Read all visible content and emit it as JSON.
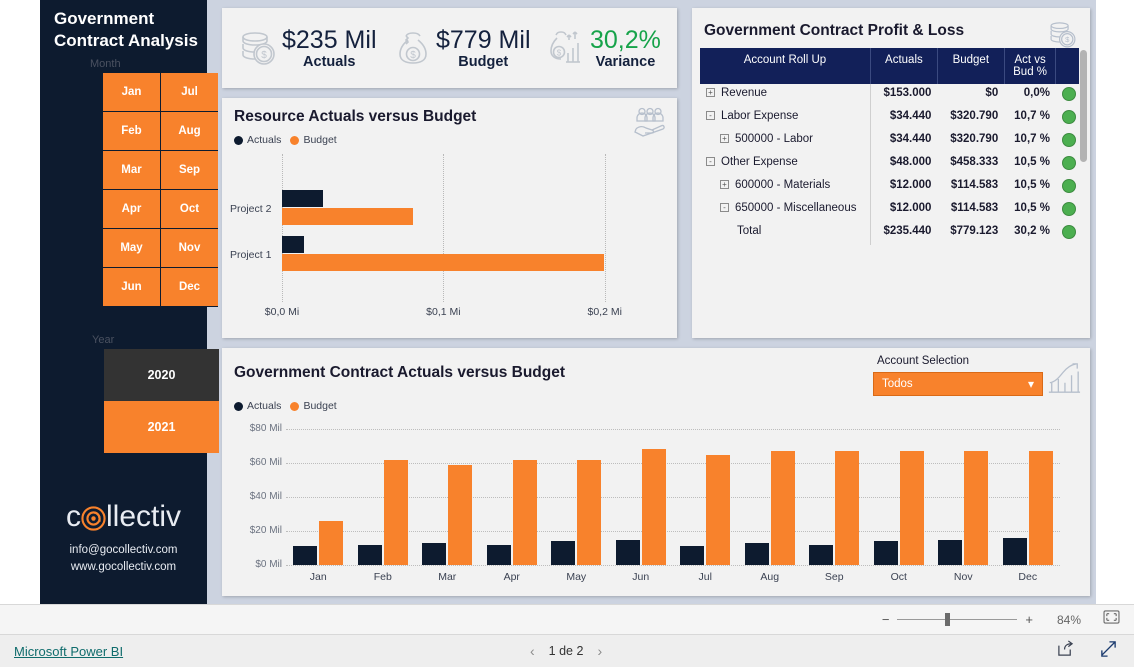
{
  "sidebar": {
    "title": "Government Contract Analysis",
    "month_label": "Month",
    "months": [
      "Jan",
      "Jul",
      "Feb",
      "Aug",
      "Mar",
      "Sep",
      "Apr",
      "Oct",
      "May",
      "Nov",
      "Jun",
      "Dec"
    ],
    "year_label": "Year",
    "years": [
      {
        "label": "2020",
        "selected": false
      },
      {
        "label": "2021",
        "selected": true
      }
    ],
    "logo": {
      "pre": "c",
      "post": "llectiv"
    },
    "email": "info@gocollectiv.com",
    "website": "www.gocollectiv.com"
  },
  "kpis": [
    {
      "value": "$235 Mil",
      "label": "Actuals",
      "icon": "coins-icon",
      "color": "#14213d"
    },
    {
      "value": "$779 Mil",
      "label": "Budget",
      "icon": "money-bag-icon",
      "color": "#14213d"
    },
    {
      "value": "30,2%",
      "label": "Variance",
      "icon": "money-growth-icon",
      "color": "#16a34a"
    }
  ],
  "resource_chart": {
    "title": "Resource Actuals versus Budget",
    "icon": "people-hand-icon",
    "legend": [
      "Actuals",
      "Budget"
    ]
  },
  "pl": {
    "title": "Government Contract Profit & Loss",
    "icon": "coins-icon",
    "columns": [
      "Account Roll Up",
      "Actuals",
      "Budget",
      "Act vs Bud %"
    ],
    "rows": [
      {
        "expander": "+",
        "indent": 0,
        "account": "Revenue",
        "actuals": "$153.000",
        "budget": "$0",
        "pct": "0,0%",
        "status": "green"
      },
      {
        "expander": "-",
        "indent": 0,
        "account": "Labor Expense",
        "actuals": "$34.440",
        "budget": "$320.790",
        "pct": "10,7 %",
        "status": "green"
      },
      {
        "expander": "+",
        "indent": 1,
        "account": "500000 - Labor",
        "actuals": "$34.440",
        "budget": "$320.790",
        "pct": "10,7 %",
        "status": "green"
      },
      {
        "expander": "-",
        "indent": 0,
        "account": "Other Expense",
        "actuals": "$48.000",
        "budget": "$458.333",
        "pct": "10,5 %",
        "status": "green"
      },
      {
        "expander": "+",
        "indent": 1,
        "account": "600000 - Materials",
        "actuals": "$12.000",
        "budget": "$114.583",
        "pct": "10,5 %",
        "status": "green"
      },
      {
        "expander": "-",
        "indent": 1,
        "account": "650000 - Miscellaneous",
        "actuals": "$12.000",
        "budget": "$114.583",
        "pct": "10,5 %",
        "status": "green"
      },
      {
        "expander": "",
        "indent": 1,
        "account": "Total",
        "actuals": "$235.440",
        "budget": "$779.123",
        "pct": "30,2 %",
        "status": "green"
      }
    ]
  },
  "column_chart": {
    "title": "Government Contract Actuals versus Budget",
    "icon": "chart-growth-icon",
    "legend": [
      "Actuals",
      "Budget"
    ],
    "account_selection_label": "Account Selection",
    "account_selection_value": "Todos"
  },
  "status_bar": {
    "power_bi_link": "Microsoft Power BI",
    "page_indicator": "1 de 2",
    "prev_icon": "chevron-left-icon",
    "next_icon": "chevron-right-icon",
    "share_icon": "share-icon",
    "fullscreen_icon": "fullscreen-icon"
  },
  "zoom_bar": {
    "minus": "−",
    "plus": "+",
    "percent": "84%",
    "fit_icon": "fit-to-page-icon"
  },
  "colors": {
    "orange": "#f8822c",
    "navy": "#0d1b2f",
    "table_header": "#122059",
    "green": "#16a34a",
    "panel_bg": "#f2f2f2",
    "report_bg": "#ccd3e0"
  },
  "chart_data": [
    {
      "type": "bar",
      "orientation": "horizontal",
      "title": "Resource Actuals versus Budget",
      "categories": [
        "Project 2",
        "Project 1"
      ],
      "series": [
        {
          "name": "Actuals",
          "color": "#0d1b2f",
          "values": [
            0.0255,
            0.0135
          ]
        },
        {
          "name": "Budget",
          "color": "#f8822c",
          "values": [
            0.0812,
            0.1997
          ]
        }
      ],
      "xlabel": "",
      "ylabel": "",
      "xticks": [
        0,
        0.1,
        0.2
      ],
      "xticklabels": [
        "$0,0 Mi",
        "$0,1 Mi",
        "$0,2 Mi"
      ],
      "xlim": [
        0,
        0.22
      ],
      "grid": true,
      "legend_position": "top-left"
    },
    {
      "type": "bar",
      "orientation": "vertical",
      "title": "Government Contract Actuals versus Budget",
      "categories": [
        "Jan",
        "Feb",
        "Mar",
        "Apr",
        "May",
        "Jun",
        "Jul",
        "Aug",
        "Sep",
        "Oct",
        "Nov",
        "Dec"
      ],
      "series": [
        {
          "name": "Actuals",
          "color": "#0d1b2f",
          "values": [
            11,
            12,
            13,
            12,
            14,
            15,
            11,
            13,
            12,
            14,
            15,
            16
          ]
        },
        {
          "name": "Budget",
          "color": "#f8822c",
          "values": [
            26,
            62,
            59,
            62,
            62,
            68,
            65,
            67,
            67,
            67,
            67,
            67
          ]
        }
      ],
      "xlabel": "",
      "ylabel": "",
      "yticks": [
        0,
        20,
        40,
        60,
        80
      ],
      "yticklabels": [
        "$0 Mil",
        "$20 Mil",
        "$40 Mil",
        "$60 Mil",
        "$80 Mil"
      ],
      "ylim": [
        0,
        80
      ],
      "grid": true,
      "legend_position": "top-left"
    }
  ]
}
